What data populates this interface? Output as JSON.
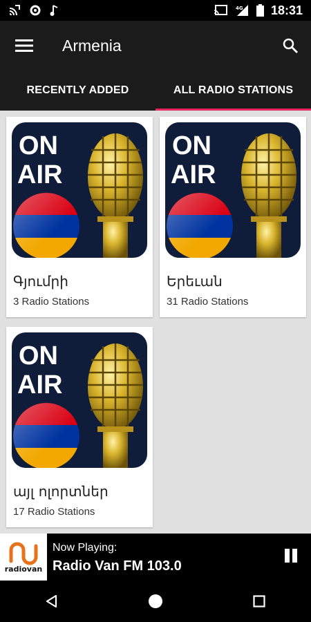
{
  "status": {
    "time": "18:31",
    "left_icons": [
      "cast-icon",
      "settings-icon",
      "music-note-icon"
    ],
    "right_icons": [
      "cast-screen-icon",
      "signal-4g-icon",
      "battery-icon"
    ],
    "network_label": "4G"
  },
  "header": {
    "title": "Armenia",
    "menu_icon": "hamburger-menu-icon",
    "search_icon": "search-icon"
  },
  "tabs": [
    {
      "label": "RECENTLY ADDED",
      "active": false
    },
    {
      "label": "ALL RADIO STATIONS",
      "active": true
    }
  ],
  "cards": [
    {
      "name": "Գյումրի",
      "count": "3 Radio Stations",
      "image_text": [
        "ON",
        "AIR"
      ]
    },
    {
      "name": "Երեւան",
      "count": "31 Radio Stations",
      "image_text": [
        "ON",
        "AIR"
      ]
    },
    {
      "name": "այլ ոլորտներ",
      "count": "17 Radio Stations",
      "image_text": [
        "ON",
        "AIR"
      ]
    }
  ],
  "player": {
    "label": "Now Playing:",
    "station": "Radio Van FM 103.0",
    "logo_text": "radiovan",
    "state_icon": "pause-icon"
  },
  "colors": {
    "accent": "#e6245e",
    "bar": "#1b1b1b",
    "content_bg": "#e1e1e1",
    "flag_red": "#d90012",
    "flag_blue": "#0033a0",
    "flag_orange": "#f2a800"
  }
}
